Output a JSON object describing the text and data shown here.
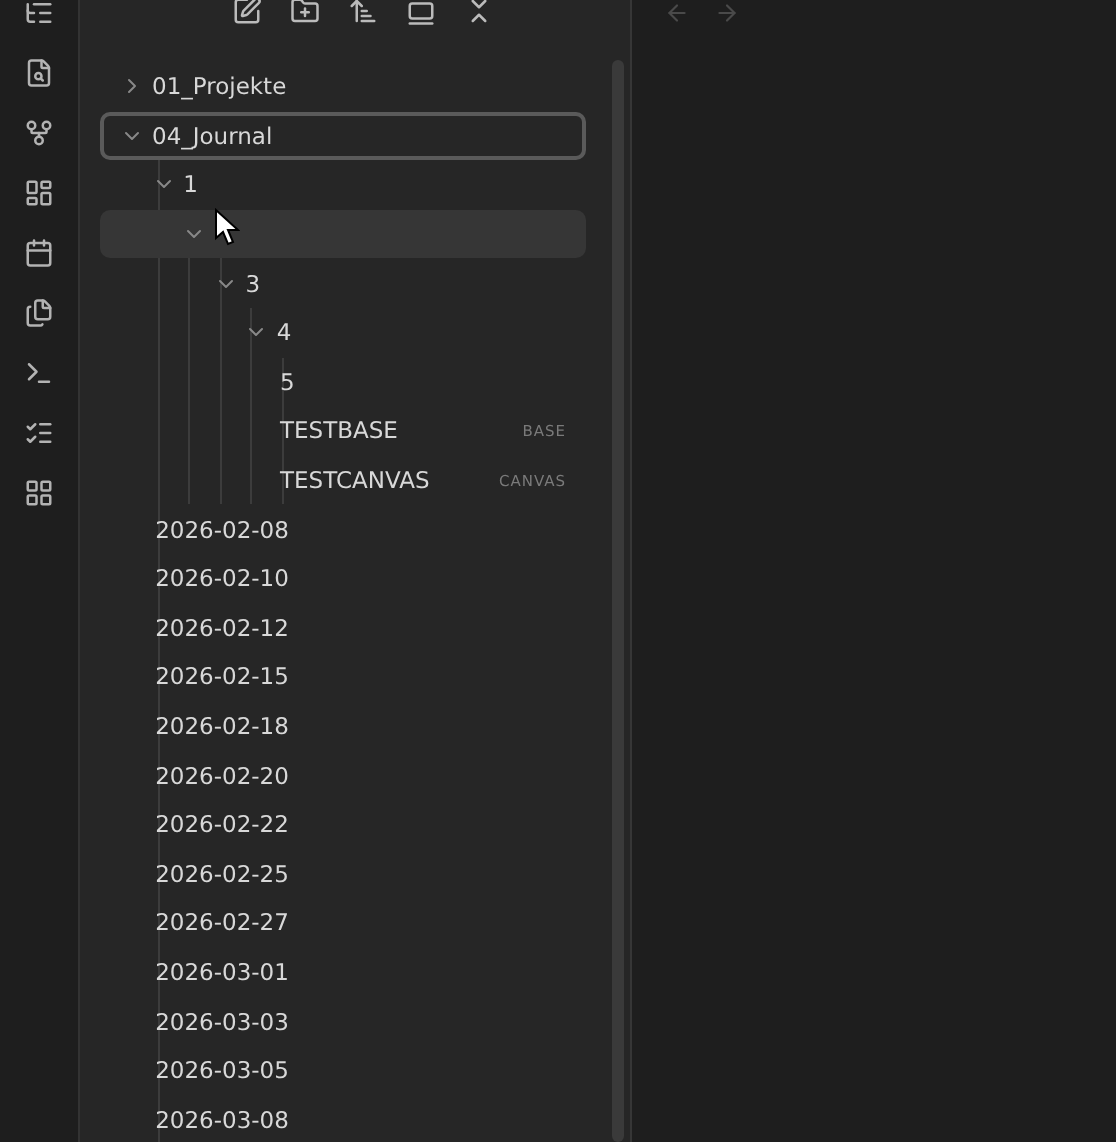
{
  "tree": [
    {
      "kind": "folder",
      "name": "01_Projekte",
      "expanded": false,
      "selected": false,
      "hovered": false
    },
    {
      "kind": "folder",
      "name": "04_Journal",
      "expanded": true,
      "selected": true,
      "hovered": false,
      "children": [
        {
          "kind": "folder",
          "name": "1",
          "expanded": true,
          "selected": false,
          "hovered": false,
          "children": [
            {
              "kind": "folder",
              "expanded": true,
              "selected": false,
              "hovered": true,
              "pointer": true,
              "children": [
                {
                  "kind": "folder",
                  "name": "3",
                  "expanded": true,
                  "selected": false,
                  "hovered": false,
                  "children": [
                    {
                      "kind": "folder",
                      "name": "4",
                      "expanded": true,
                      "selected": false,
                      "hovered": false,
                      "children": [
                        {
                          "kind": "file",
                          "name": "5",
                          "selected": false,
                          "hovered": false
                        },
                        {
                          "kind": "file",
                          "name": "TESTBASE",
                          "tag": "BASE",
                          "selected": false,
                          "hovered": false
                        },
                        {
                          "kind": "file",
                          "name": "TESTCANVAS",
                          "tag": "CANVAS",
                          "selected": false,
                          "hovered": false
                        }
                      ]
                    }
                  ]
                }
              ]
            }
          ]
        },
        {
          "kind": "file",
          "name": "2026-02-08",
          "selected": false,
          "hovered": false
        },
        {
          "kind": "file",
          "name": "2026-02-10",
          "selected": false,
          "hovered": false
        },
        {
          "kind": "file",
          "name": "2026-02-12",
          "selected": false,
          "hovered": false
        },
        {
          "kind": "file",
          "name": "2026-02-15",
          "selected": false,
          "hovered": false
        },
        {
          "kind": "file",
          "name": "2026-02-18",
          "selected": false,
          "hovered": false
        },
        {
          "kind": "file",
          "name": "2026-02-20",
          "selected": false,
          "hovered": false
        },
        {
          "kind": "file",
          "name": "2026-02-22",
          "selected": false,
          "hovered": false
        },
        {
          "kind": "file",
          "name": "2026-02-25",
          "selected": false,
          "hovered": false
        },
        {
          "kind": "file",
          "name": "2026-02-27",
          "selected": false,
          "hovered": false
        },
        {
          "kind": "file",
          "name": "2026-03-01",
          "selected": false,
          "hovered": false
        },
        {
          "kind": "file",
          "name": "2026-03-03",
          "selected": false,
          "hovered": false
        },
        {
          "kind": "file",
          "name": "2026-03-05",
          "selected": false,
          "hovered": false
        },
        {
          "kind": "file",
          "name": "2026-03-08",
          "selected": false,
          "hovered": false
        }
      ]
    }
  ],
  "nav": {
    "back_enabled": false,
    "forward_enabled": false
  }
}
